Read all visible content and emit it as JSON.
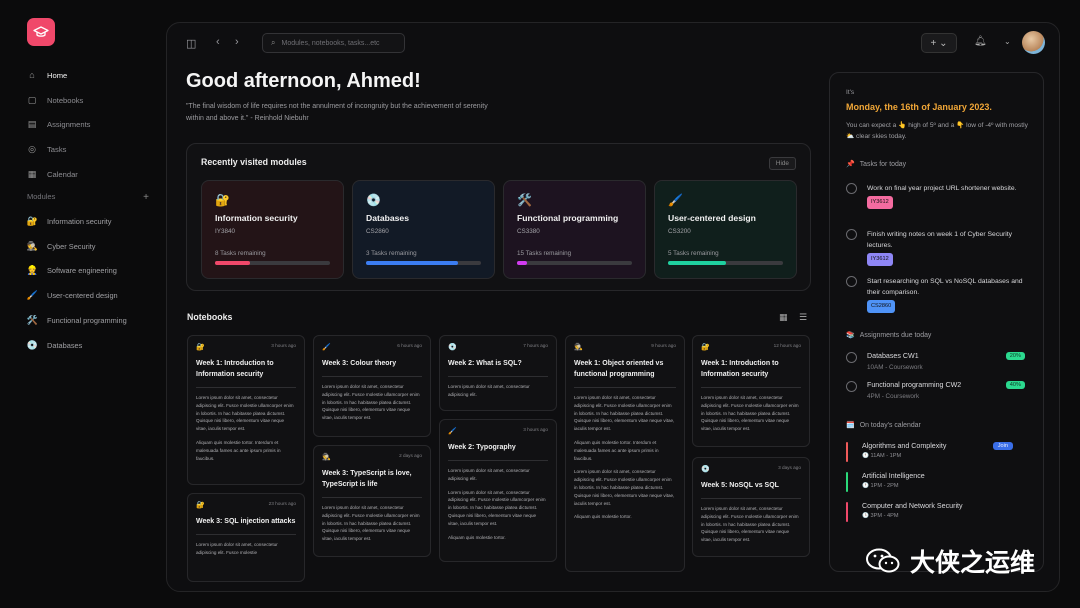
{
  "sidebar": {
    "nav": [
      {
        "label": "Home",
        "icon": "home-icon"
      },
      {
        "label": "Notebooks",
        "icon": "notebook-icon"
      },
      {
        "label": "Assignments",
        "icon": "assignment-icon"
      },
      {
        "label": "Tasks",
        "icon": "check-circle-icon"
      },
      {
        "label": "Calendar",
        "icon": "calendar-icon"
      }
    ],
    "modules_heading": "Modules",
    "modules_add": "+",
    "modules": [
      {
        "label": "Information security",
        "emoji": "🔐"
      },
      {
        "label": "Cyber Security",
        "emoji": "🕵️"
      },
      {
        "label": "Software engineering",
        "emoji": "👷"
      },
      {
        "label": "User-centered design",
        "emoji": "🖌️"
      },
      {
        "label": "Functional programming",
        "emoji": "🛠️"
      },
      {
        "label": "Databases",
        "emoji": "💿"
      }
    ]
  },
  "topbar": {
    "search_placeholder": "Modules, notebooks, tasks...etc",
    "add_label": "+ ⌄"
  },
  "greeting": "Good afternoon, Ahmed!",
  "quote": "\"The final wisdom of life requires not the annulment of incongruity but the achievement of serenity within and above it.\" - Reinhold Niebuhr",
  "recent": {
    "title": "Recently visited modules",
    "hide_label": "Hide",
    "modules": [
      {
        "emoji": "🔐",
        "title": "Information security",
        "code": "IY3840",
        "remaining": "8 Tasks remaining",
        "progress": 0.3,
        "color": "#f0486a",
        "bg": "#231417"
      },
      {
        "emoji": "💿",
        "title": "Databases",
        "code": "CS2860",
        "remaining": "3 Tasks remaining",
        "progress": 0.8,
        "color": "#3b7df2",
        "bg": "#121a26"
      },
      {
        "emoji": "🛠️",
        "title": "Functional programming",
        "code": "CS3380",
        "remaining": "15 Tasks remaining",
        "progress": 0.09,
        "color": "#d23bf0",
        "bg": "#1d1320"
      },
      {
        "emoji": "🖌️",
        "title": "User-centered design",
        "code": "CS3200",
        "remaining": "5 Tasks remaining",
        "progress": 0.5,
        "color": "#1fd1a0",
        "bg": "#101f1c"
      }
    ]
  },
  "notebooks": {
    "title": "Notebooks",
    "lorem1": "Lorem ipsum dolor sit amet, consectetur adipiscing elit. Fusce molestie ullamcorper enim in lobortis. In hac habitasse platea dictumst. Quisque nisi libero, elementum vitae neque vitae, iaculis tempor est.",
    "lorem2": "Aliquam quis molestie tortor. Interdum et malesuada fames ac ante ipsum primis in faucibus.",
    "lorem_short": "Lorem ipsum dolor sit amet, consectetur adipiscing elit. Fusce molestie",
    "lorem_short2": "Lorem ipsum dolor sit amet, consectetur adipiscing elit.",
    "lorem_tail": "Aliquam quis molestie tortor.",
    "items": [
      {
        "emoji": "🔐",
        "time": "3 hours ago",
        "title": "Week 1: Introduction to Information security"
      },
      {
        "emoji": "🔐",
        "time": "23 hours ago",
        "title": "Week 3: SQL injection attacks"
      },
      {
        "emoji": "🖌️",
        "time": "6 hours ago",
        "title": "Week 3: Colour theory"
      },
      {
        "emoji": "🕵️",
        "time": "2 days ago",
        "title": "Week 3: TypeScript is love, TypeScript is life"
      },
      {
        "emoji": "💿",
        "time": "7 hours ago",
        "title": "Week 2: What is SQL?"
      },
      {
        "emoji": "🖌️",
        "time": "3 hours ago",
        "title": "Week 2: Typography"
      },
      {
        "emoji": "🕵️",
        "time": "9 hours ago",
        "title": "Week 1: Object oriented vs functional programming"
      },
      {
        "emoji": "🔐",
        "time": "12 hours ago",
        "title": "Week 1: Introduction to Information security"
      },
      {
        "emoji": "💿",
        "time": "3 days ago",
        "title": "Week 5: NoSQL vs SQL"
      }
    ]
  },
  "right": {
    "its": "It's",
    "date": "Monday, the 16th of January 2023.",
    "weather": "You can expect a 👆 high of 5º and a 👇 low of -4º with mostly ⛅ clear skies today.",
    "tasks_heading": "Tasks for today",
    "tasks_emoji": "📌",
    "tasks": [
      {
        "text": "Work on final year project URL shortener website.",
        "tag": "IY3612",
        "tag_color": "#f46ba0"
      },
      {
        "text": "Finish writing notes on week 1 of Cyber Security lectures.",
        "tag": "IY3612",
        "tag_color": "#8e86f5"
      },
      {
        "text": "Start researching on SQL vs NoSQL databases and their comparison.",
        "tag": "CS2860",
        "tag_color": "#4f93f7"
      }
    ],
    "assign_heading": "Assignments due today",
    "assign_emoji": "📚",
    "assignments": [
      {
        "title": "Databases CW1",
        "sub": "10AM - Coursework",
        "pct": "20%"
      },
      {
        "title": "Functional programming CW2",
        "sub": "4PM - Coursework",
        "pct": "40%"
      }
    ],
    "cal_heading": "On today's calendar",
    "cal_emoji": "🗓️",
    "events": [
      {
        "title": "Algorithms and Complexity",
        "time": "🕚 11AM - 1PM",
        "color": "#f05a5a",
        "badge": "Join"
      },
      {
        "title": "Artificial Intelligence",
        "time": "🕐 1PM - 2PM",
        "color": "#2bd97a",
        "badge": ""
      },
      {
        "title": "Computer and Network Security",
        "time": "🕒 3PM - 4PM",
        "color": "#f0486a",
        "badge": ""
      }
    ]
  },
  "watermark": "大侠之运维",
  "colors": {
    "accent": "#f0486a",
    "date": "#f0a637"
  }
}
